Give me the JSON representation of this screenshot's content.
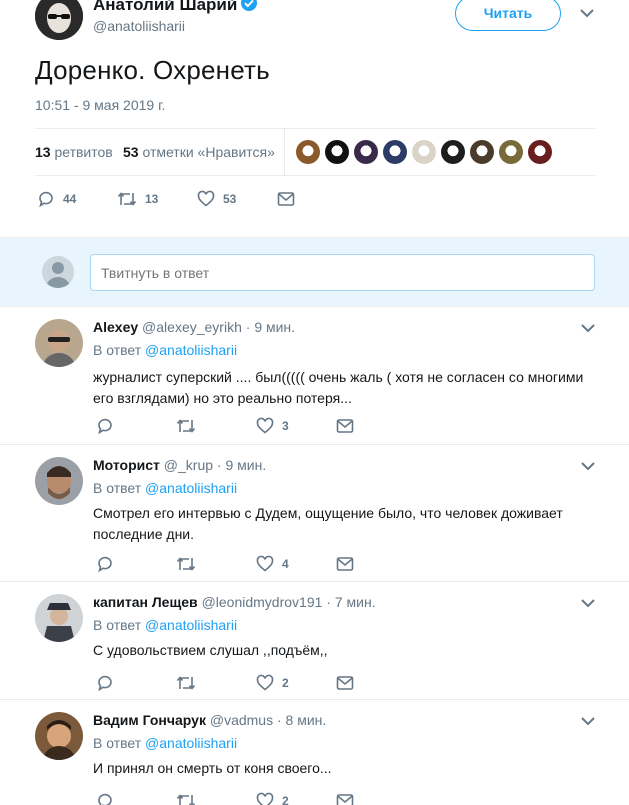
{
  "main_tweet": {
    "author_name": "Анатолий Шарий",
    "handle": "@anatoliisharii",
    "follow_label": "Читать",
    "text": "Доренко. Охренеть",
    "timestamp": "10:51 - 9 мая 2019 г.",
    "retweets_count": "13",
    "retweets_label": "ретвитов",
    "likes_count": "53",
    "likes_label": "отметки «Нравится»",
    "actions": {
      "replies": "44",
      "retweets": "13",
      "likes": "53"
    },
    "liker_colors": [
      "#8a5a2b",
      "#111111",
      "#3a2a4a",
      "#2b3c66",
      "#d9d3c8",
      "#1e1e1e",
      "#4a3b2c",
      "#7a6a3a",
      "#6a1e1e"
    ]
  },
  "reply_box": {
    "placeholder": "Твитнуть в ответ"
  },
  "replies": [
    {
      "name": "Alexey",
      "handle": "@alexey_eyrikh",
      "time": "9 мин.",
      "in_reply_prefix": "В ответ",
      "in_reply_to": "@anatoliisharii",
      "text": "журналист суперский .... был((((( очень жаль ( хотя не согласен со многими его взглядами) но это реально потеря...",
      "likes": "3"
    },
    {
      "name": "Моторист",
      "handle": "@_krup",
      "time": "9 мин.",
      "in_reply_prefix": "В ответ",
      "in_reply_to": "@anatoliisharii",
      "text": "Смотрел его интервью с Дудем, ощущение было, что человек доживает последние дни.",
      "likes": "4"
    },
    {
      "name": "капитан Лещев",
      "handle": "@leonidmydrov191",
      "time": "7 мин.",
      "in_reply_prefix": "В ответ",
      "in_reply_to": "@anatoliisharii",
      "text": "С удовольствием слушал ,,подъём,,",
      "likes": "2"
    },
    {
      "name": "Вадим Гончарук",
      "handle": "@vadmus",
      "time": "8 мин.",
      "in_reply_prefix": "В ответ",
      "in_reply_to": "@anatoliisharii",
      "text": "И принял он смерть от коня своего...",
      "likes": "2"
    }
  ],
  "colors": {
    "accent": "#1da1f2",
    "muted": "#657786",
    "text": "#14171a",
    "border": "#e6ecf0",
    "reply_bg": "#e8f5fd"
  }
}
